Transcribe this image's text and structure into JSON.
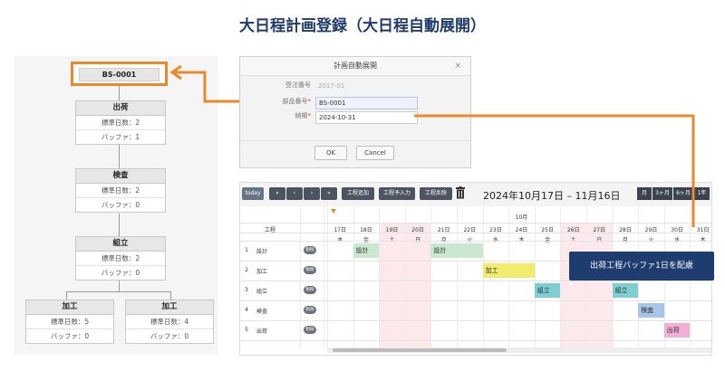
{
  "page_title": "大日程計画登録（大日程自動展開）",
  "flow": {
    "top_code": "BS-0001",
    "nodes": [
      {
        "title": "出荷",
        "rows": [
          "標準日数：2",
          "バッファ：1"
        ]
      },
      {
        "title": "検査",
        "rows": [
          "標準日数：2",
          "バッファ：0"
        ]
      },
      {
        "title": "組立",
        "rows": [
          "標準日数：2",
          "バッファ：0"
        ]
      },
      {
        "title": "加工",
        "rows": [
          "標準日数：5",
          "バッファ：0"
        ]
      },
      {
        "title": "加工",
        "rows": [
          "標準日数：4",
          "バッファ：0"
        ]
      }
    ]
  },
  "dialog": {
    "title": "計画自動展開",
    "close": "×",
    "fields": [
      {
        "label": "受注番号",
        "required": false,
        "value": "2017-01"
      },
      {
        "label": "部品番号",
        "required": true,
        "value": "BS-0001"
      },
      {
        "label": "納期",
        "required": true,
        "value": "2024-10-31"
      }
    ],
    "ok": "OK",
    "cancel": "Cancel"
  },
  "gantt": {
    "toolbar": {
      "today": "today",
      "nav": [
        "«",
        "‹",
        "›",
        "»"
      ],
      "buttons": [
        "工程追加",
        "工程予入力",
        "工程反映"
      ],
      "range": "2024年10月17日 – 11月16日",
      "views": [
        "月",
        "3ヶ月",
        "6ヶ月",
        "1年"
      ]
    },
    "col_header": "工程",
    "month": "10月",
    "days": [
      "17日",
      "18日",
      "19日",
      "20日",
      "21日",
      "22日",
      "23日",
      "24日",
      "25日",
      "26日",
      "27日",
      "28日",
      "29日",
      "30日",
      "31日"
    ],
    "weekdays": [
      "木",
      "金",
      "土",
      "日",
      "月",
      "火",
      "水",
      "木",
      "金",
      "土",
      "日",
      "月",
      "火",
      "水",
      "木"
    ],
    "rows": [
      {
        "no": "1",
        "name": "設計",
        "tag": "削除"
      },
      {
        "no": "2",
        "name": "加工",
        "tag": "削除"
      },
      {
        "no": "3",
        "name": "組立",
        "tag": "削除"
      },
      {
        "no": "4",
        "name": "検査",
        "tag": "削除"
      },
      {
        "no": "5",
        "name": "出荷",
        "tag": "削除"
      }
    ],
    "bars": [
      {
        "row": 0,
        "start": 1,
        "span": 1,
        "label": "設計",
        "color": "#c9e8cf"
      },
      {
        "row": 0,
        "start": 4,
        "span": 2,
        "label": "設計",
        "color": "#c9e8cf"
      },
      {
        "row": 1,
        "start": 6,
        "span": 2,
        "label": "加工",
        "color": "#f1ec6b"
      },
      {
        "row": 2,
        "start": 8,
        "span": 1,
        "label": "組立",
        "color": "#7ccfd3"
      },
      {
        "row": 2,
        "start": 11,
        "span": 1,
        "label": "組立",
        "color": "#7ccfd3"
      },
      {
        "row": 3,
        "start": 12,
        "span": 1,
        "label": "検査",
        "color": "#a9c4ea"
      },
      {
        "row": 4,
        "start": 13,
        "span": 1,
        "label": "出荷",
        "color": "#f3aed6"
      }
    ]
  },
  "tooltip": "出荷工程バッファ1日を配慮",
  "colors": {
    "accent": "#e8892c",
    "title": "#1f3a6b",
    "tooltip": "#1f3c6e"
  }
}
